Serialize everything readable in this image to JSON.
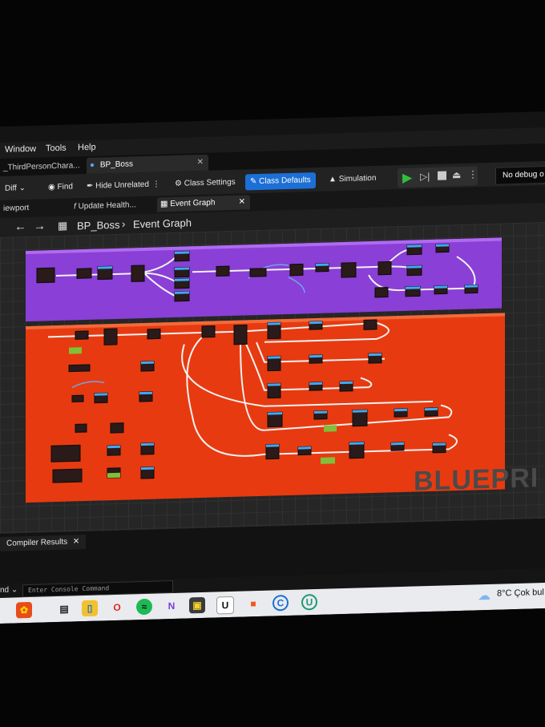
{
  "menu": [
    "Window",
    "Tools",
    "Help"
  ],
  "tabs": [
    {
      "label": "_ThirdPersonChara..."
    },
    {
      "label": "BP_Boss",
      "active": true
    }
  ],
  "toolbar": {
    "diff": "Diff",
    "find": "Find",
    "hide_unrelated": "Hide Unrelated",
    "class_settings": "Class Settings",
    "class_defaults": "Class Defaults",
    "simulation": "Simulation",
    "debug": "No debug o"
  },
  "subtabs": [
    {
      "label": "iewport"
    },
    {
      "label": "Update Health..."
    },
    {
      "label": "Event Graph",
      "active": true
    }
  ],
  "breadcrumb": {
    "root": "BP_Boss",
    "separator": "›",
    "current": "Event Graph"
  },
  "graph": {
    "watermark": "BLUEPRI",
    "comment_colors": {
      "top": "#8a3fd6",
      "bottom": "#e83a10"
    }
  },
  "bottom": {
    "compiler_tab": "Compiler Results",
    "console_label": "nd",
    "console_placeholder": "Enter Console Command"
  },
  "taskbar": {
    "weather": "8°C  Çok bul"
  },
  "colors": {
    "accent": "#1c6fd6",
    "play_green": "#2fbf3a"
  }
}
